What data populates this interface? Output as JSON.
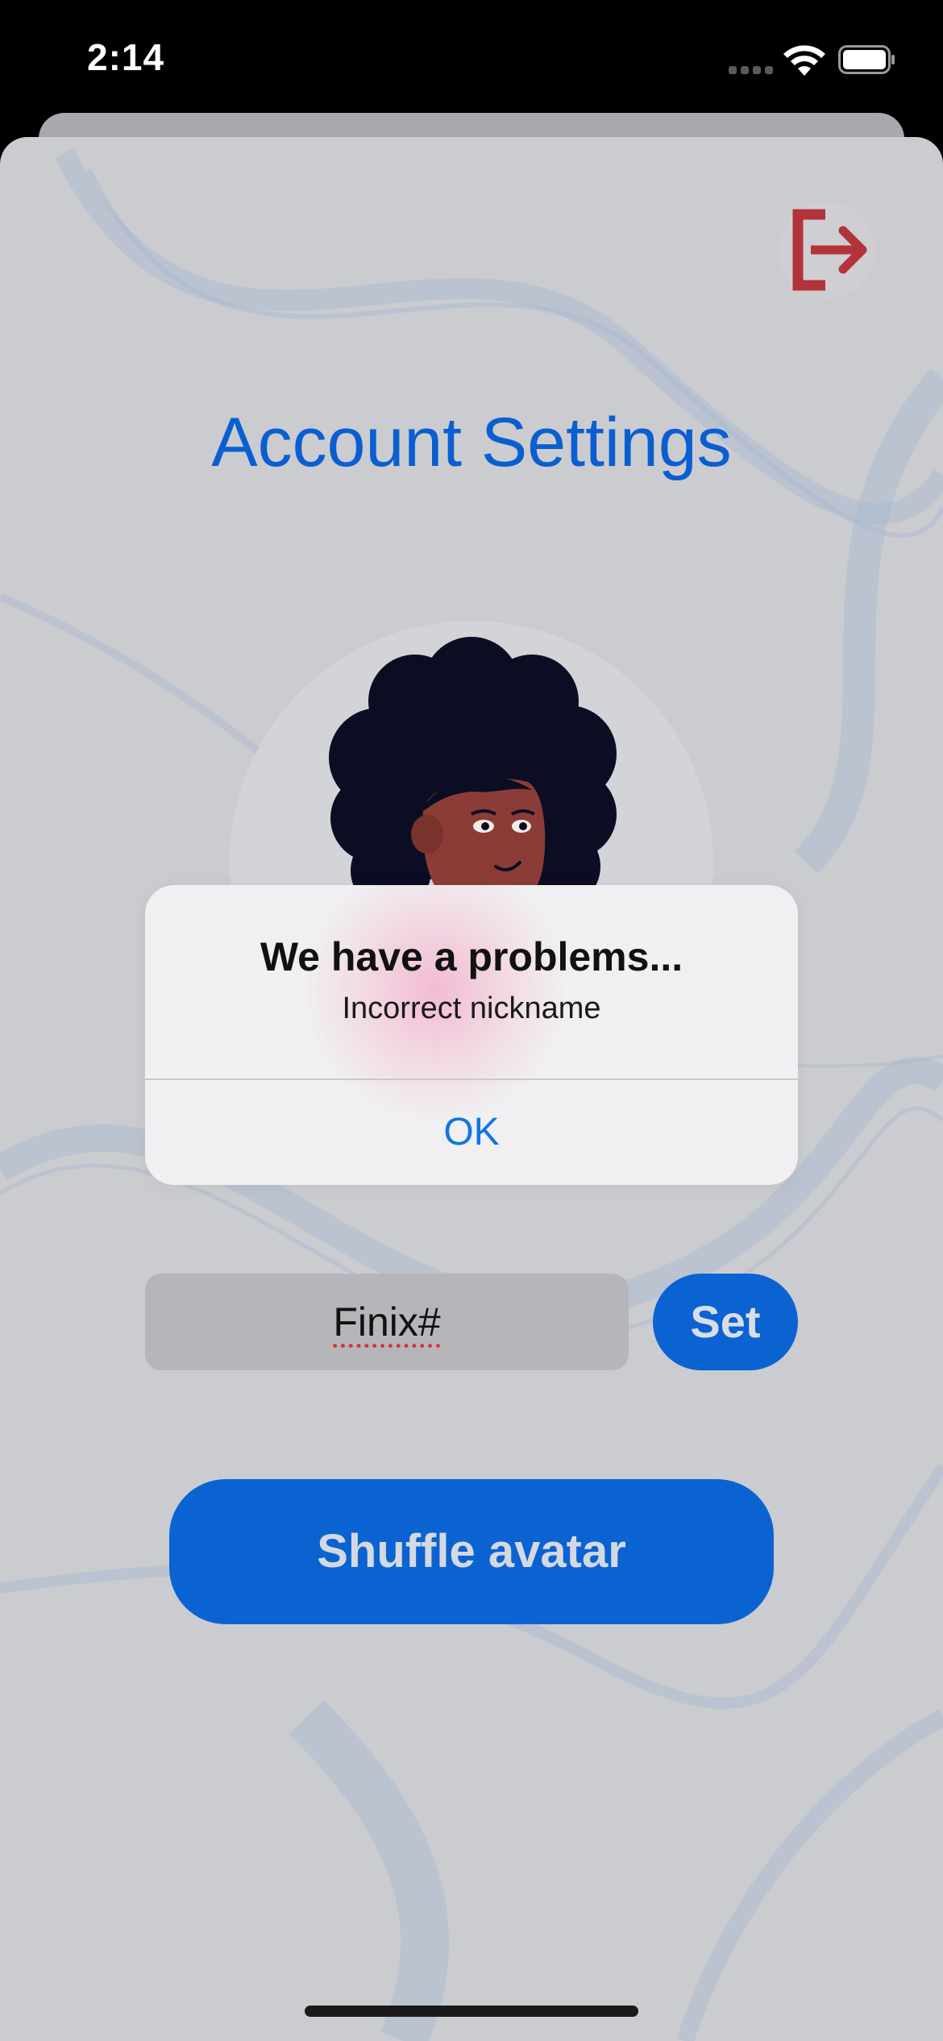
{
  "status_bar": {
    "time": "2:14",
    "icons": [
      "cellular-signal-icon",
      "wifi-icon",
      "battery-icon"
    ]
  },
  "header": {
    "logout_icon": "logout-icon",
    "title": "Account Settings"
  },
  "avatar": {
    "icon": "avatar-illustration"
  },
  "nickname": {
    "value": "Finix#",
    "set_label": "Set",
    "spellcheck_underline": true
  },
  "shuffle": {
    "label": "Shuffle avatar"
  },
  "alert": {
    "title": "We have a problems...",
    "message": "Incorrect nickname",
    "ok_label": "OK"
  },
  "colors": {
    "accent": "#0a63d1",
    "title_blue": "#0a5fd0",
    "logout_red": "#b3333b",
    "background": "#cbccd0",
    "alert_button": "#1274e0"
  }
}
